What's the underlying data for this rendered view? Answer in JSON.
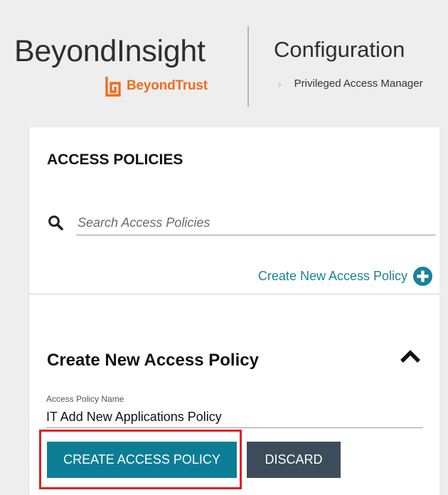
{
  "header": {
    "app_title": "BeyondInsight",
    "brand_name": "BeyondTrust",
    "section_title": "Configuration",
    "breadcrumb": "Privileged Access Manager"
  },
  "panel": {
    "title": "ACCESS POLICIES",
    "search": {
      "placeholder": "Search Access Policies",
      "value": ""
    },
    "create_link_label": "Create New Access Policy"
  },
  "form": {
    "title": "Create New Access Policy",
    "field_label": "Access Policy Name",
    "field_value": "IT Add New Applications Policy",
    "create_button": "CREATE ACCESS POLICY",
    "discard_button": "DISCARD"
  },
  "colors": {
    "brand_orange": "#ef6d1f",
    "primary_teal": "#0b7e95",
    "link_teal": "#17829c",
    "discard_slate": "#3c4c5a",
    "highlight_red": "#e01f26",
    "page_background": "#eeeeee"
  },
  "icons": {
    "brand": "beyondtrust-logo-icon",
    "search": "search-icon",
    "add": "plus-circle-icon",
    "collapse": "chevron-up-icon",
    "breadcrumb_separator": "chevron-right-icon"
  }
}
